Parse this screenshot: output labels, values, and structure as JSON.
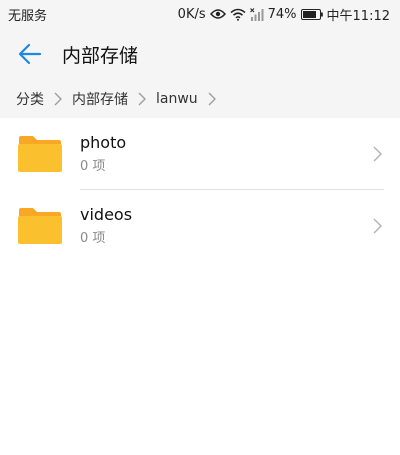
{
  "status_bar": {
    "carrier": "无服务",
    "net_speed": "0K/s",
    "battery": "74%",
    "time": "中午11:12"
  },
  "header": {
    "title": "内部存储"
  },
  "breadcrumb": [
    {
      "label": "分类"
    },
    {
      "label": "内部存储"
    },
    {
      "label": "lanwu"
    }
  ],
  "files": [
    {
      "name": "photo",
      "count": "0 项"
    },
    {
      "name": "videos",
      "count": "0 项"
    }
  ],
  "colors": {
    "accent": "#1e88e5",
    "folder": "#fbc02d",
    "folder_tab": "#f9a825",
    "bar_bg": "#f5f5f5"
  }
}
